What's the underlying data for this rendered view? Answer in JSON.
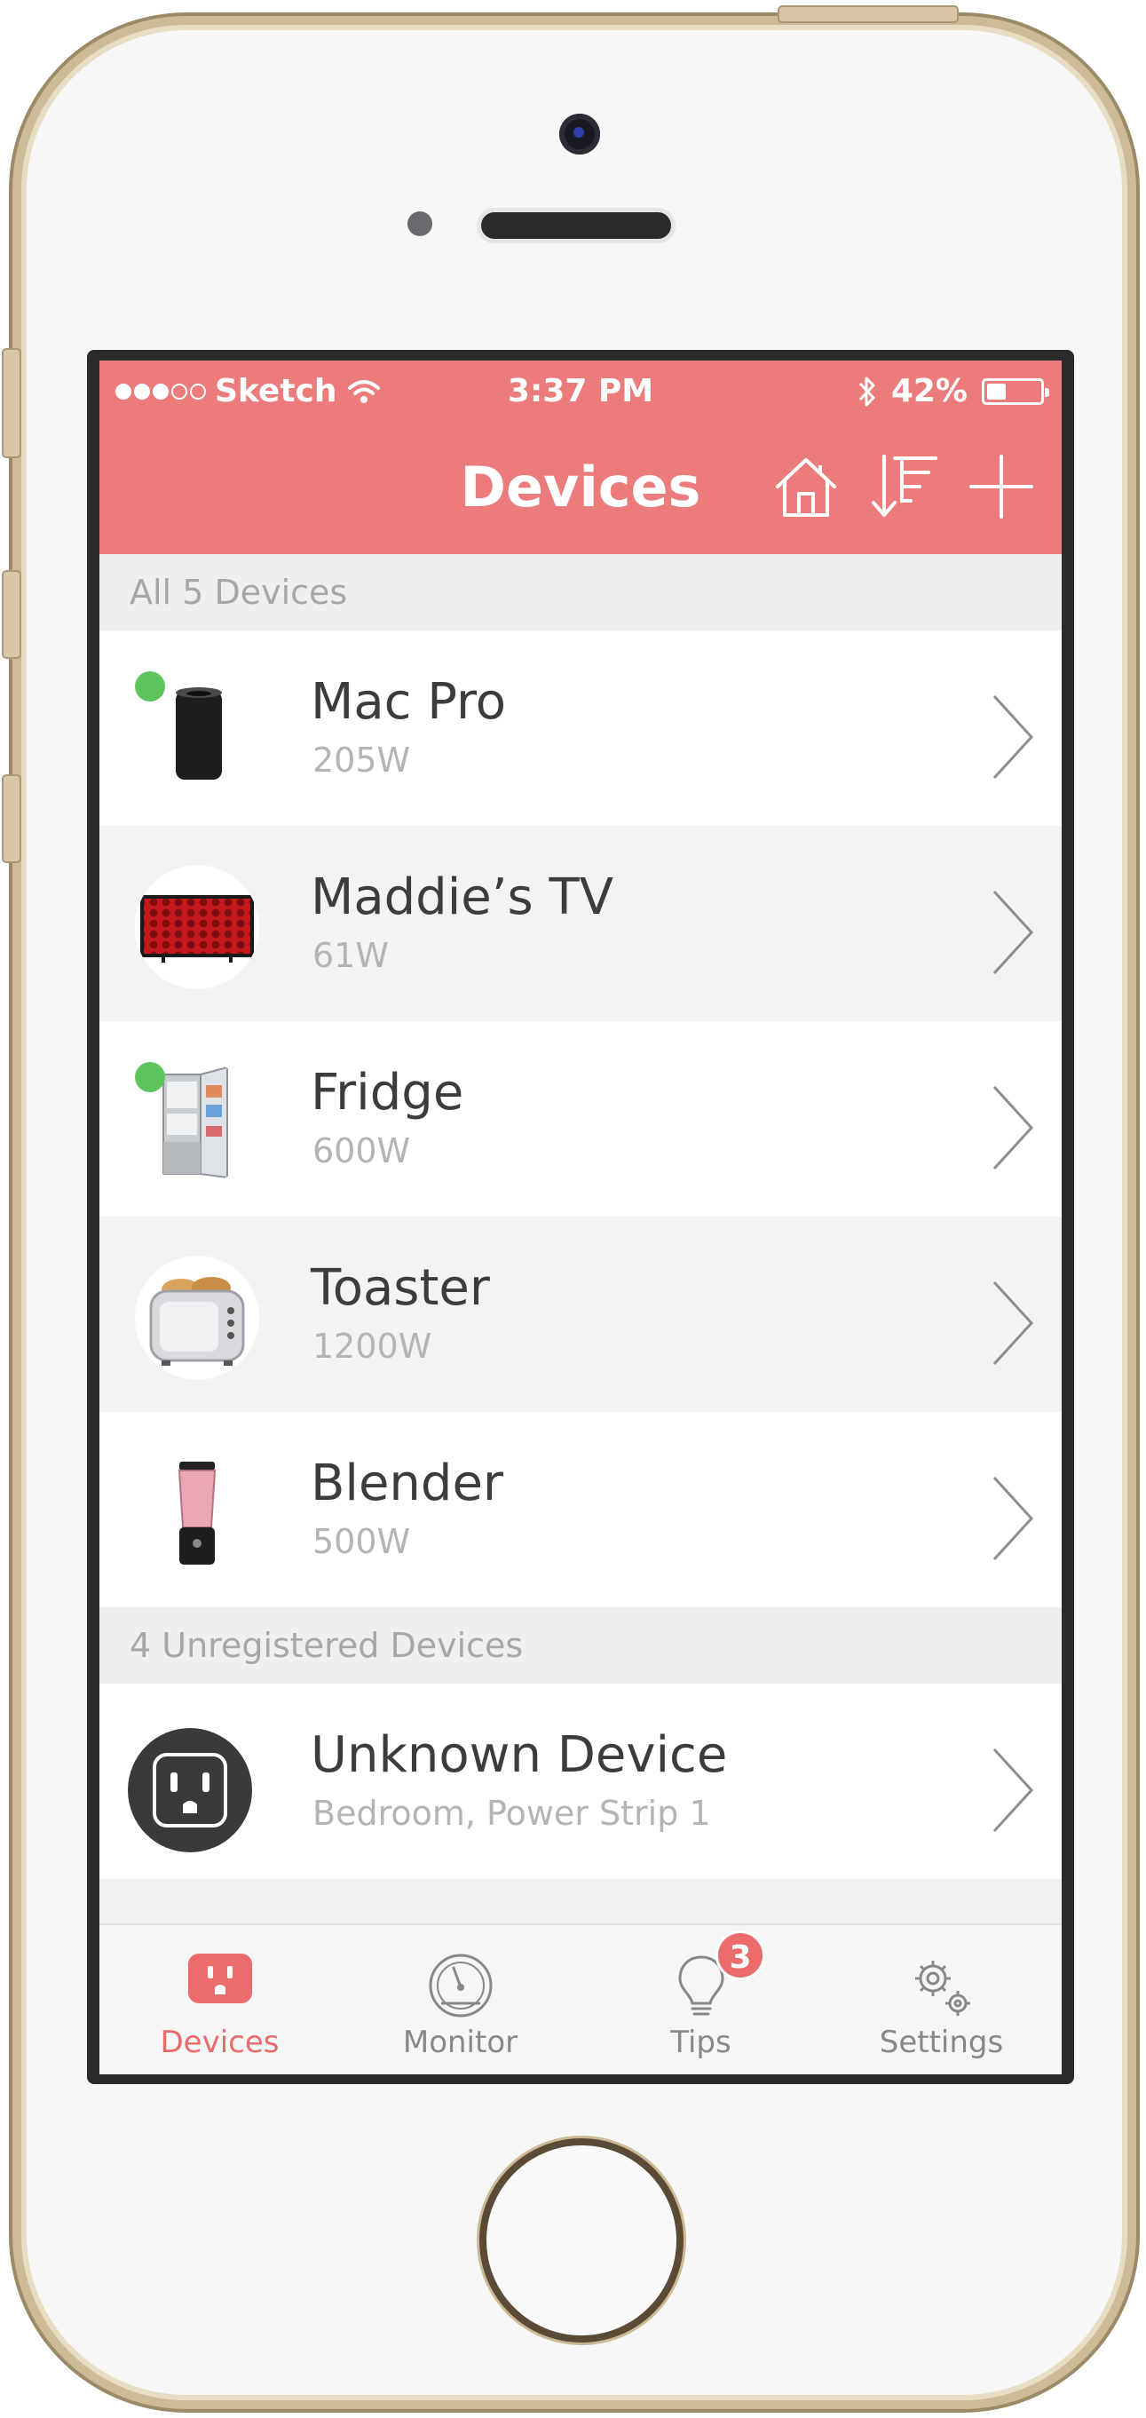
{
  "status_bar": {
    "carrier": "Sketch",
    "time": "3:37 PM",
    "battery_text": "42%",
    "battery_level": 0.42
  },
  "header": {
    "title": "Devices"
  },
  "sections": {
    "registered": "All 5 Devices",
    "unregistered": "4 Unregistered Devices"
  },
  "devices": [
    {
      "name": "Mac Pro",
      "power": "205W",
      "online": true
    },
    {
      "name": "Maddie’s TV",
      "power": "61W",
      "online": false
    },
    {
      "name": "Fridge",
      "power": "600W",
      "online": true
    },
    {
      "name": "Toaster",
      "power": "1200W",
      "online": false
    },
    {
      "name": "Blender",
      "power": "500W",
      "online": false
    }
  ],
  "unknown_device": {
    "name": "Unknown Device",
    "location": "Bedroom, Power Strip 1"
  },
  "tabs": [
    {
      "label": "Devices",
      "icon": "outlet-icon",
      "active": true
    },
    {
      "label": "Monitor",
      "icon": "gauge-icon",
      "active": false
    },
    {
      "label": "Tips",
      "icon": "lightbulb-icon",
      "active": false,
      "badge": "3"
    },
    {
      "label": "Settings",
      "icon": "gears-icon",
      "active": false
    }
  ],
  "colors": {
    "accent": "#ec7b7b",
    "online": "#5dc35d"
  }
}
